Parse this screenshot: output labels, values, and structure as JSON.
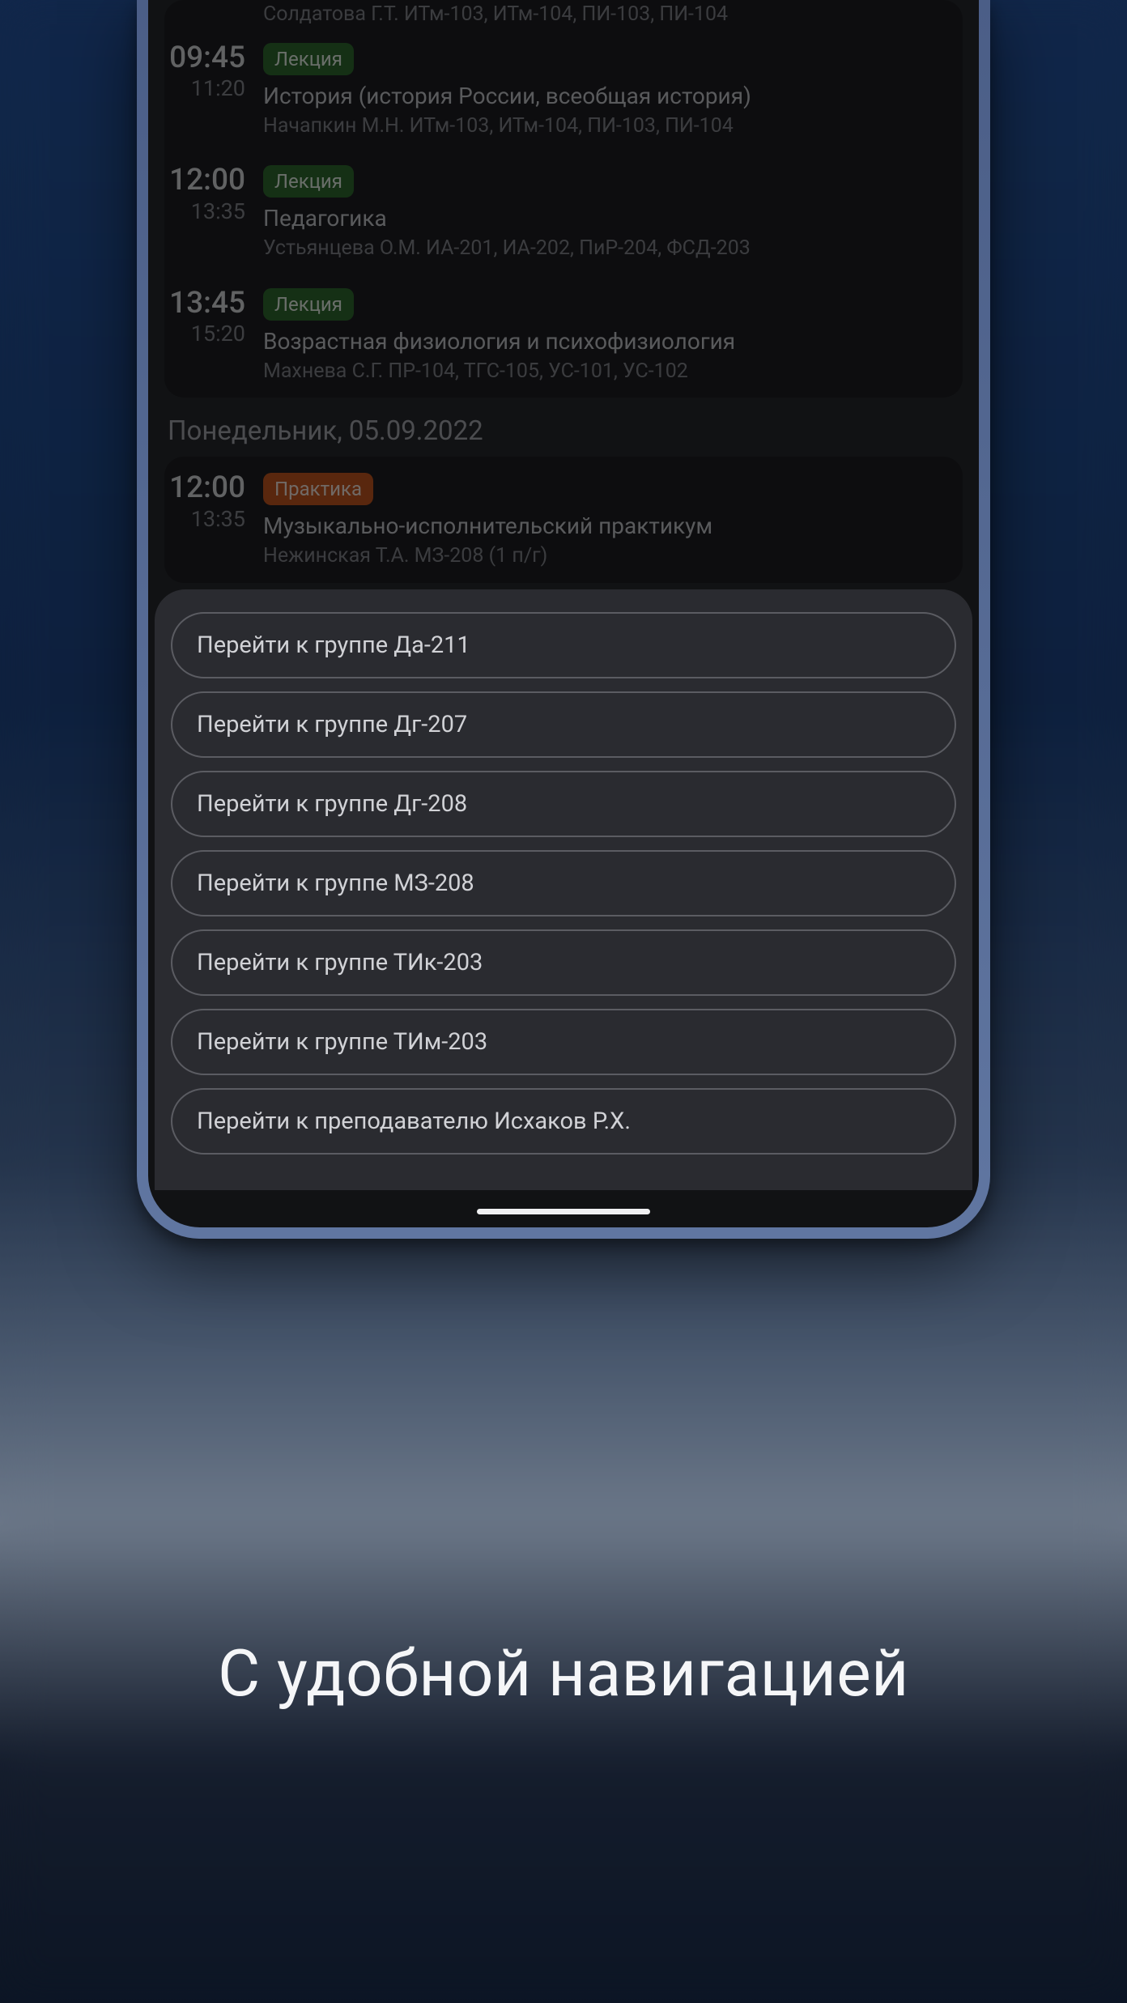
{
  "caption": "С удобной навигацией",
  "schedule": {
    "item0": {
      "teacher": "Солдатова Г.Т. ИТм-103, ИТм-104, ПИ-103, ПИ-104"
    },
    "item1": {
      "start": "09:45",
      "end": "11:20",
      "badge": "Лекция",
      "subject": "История (история России, всеобщая история)",
      "teacher": "Начапкин М.Н. ИТм-103, ИТм-104, ПИ-103, ПИ-104"
    },
    "item2": {
      "start": "12:00",
      "end": "13:35",
      "badge": "Лекция",
      "subject": "Педагогика",
      "teacher": "Устьянцева О.М. ИА-201, ИА-202, ПиР-204, ФСД-203"
    },
    "item3": {
      "start": "13:45",
      "end": "15:20",
      "badge": "Лекция",
      "subject": "Возрастная физиология и психофизиология",
      "teacher": "Махнева С.Г. ПР-104, ТГС-105, УС-101, УС-102"
    },
    "dateHeader": "Понедельник, 05.09.2022",
    "item4": {
      "start": "12:00",
      "end": "13:35",
      "badge": "Практика",
      "subject": "Музыкально-исполнительский практикум",
      "teacher": "Нежинская Т.А. МЗ-208 (1 п/г)"
    }
  },
  "nav": {
    "b0": "Перейти к группе Да-211",
    "b1": "Перейти к группе Дг-207",
    "b2": "Перейти к группе Дг-208",
    "b3": "Перейти к группе МЗ-208",
    "b4": "Перейти к группе ТИк-203",
    "b5": "Перейти к группе ТИм-203",
    "b6": "Перейти к преподавателю Исхаков Р.Х."
  }
}
